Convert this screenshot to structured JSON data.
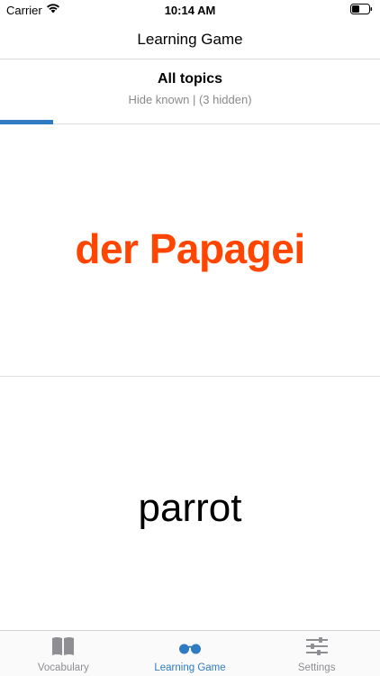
{
  "status_bar": {
    "carrier": "Carrier",
    "time": "10:14 AM"
  },
  "nav": {
    "title": "Learning Game"
  },
  "topic": {
    "title": "All topics",
    "filter_text": "Hide known | (3 hidden)",
    "progress_fraction": 0.14
  },
  "card": {
    "foreign_word": "der Papagei",
    "native_word": "parrot"
  },
  "tabs": [
    {
      "label": "Vocabulary",
      "icon": "book-icon",
      "active": false
    },
    {
      "label": "Learning Game",
      "icon": "glasses-icon",
      "active": true
    },
    {
      "label": "Settings",
      "icon": "sliders-icon",
      "active": false
    }
  ],
  "colors": {
    "accent": "#2e7bc1",
    "foreign_word": "#ff4500",
    "inactive_tab": "#8e8e93"
  }
}
